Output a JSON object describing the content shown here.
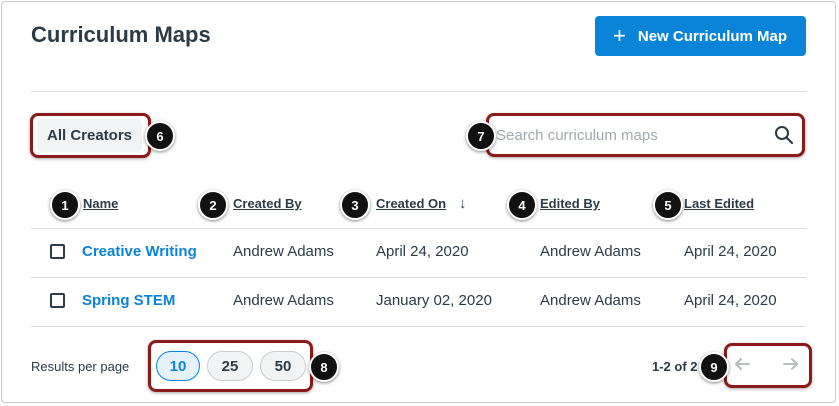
{
  "header": {
    "title": "Curriculum Maps",
    "new_button_label": "New Curriculum Map",
    "new_button_icon": "plus-icon"
  },
  "filter": {
    "creators_label": "All Creators"
  },
  "search": {
    "placeholder": "Search curriculum maps",
    "value": "",
    "icon": "search-icon"
  },
  "table": {
    "columns": [
      "Name",
      "Created By",
      "Created On",
      "Edited By",
      "Last Edited"
    ],
    "sort_indicator": "↓",
    "rows": [
      {
        "name": "Creative Writing",
        "created_by": "Andrew Adams",
        "created_on": "April 24, 2020",
        "edited_by": "Andrew Adams",
        "last_edited": "April 24, 2020"
      },
      {
        "name": "Spring STEM",
        "created_by": "Andrew Adams",
        "created_on": "January 02, 2020",
        "edited_by": "Andrew Adams",
        "last_edited": "April 24, 2020"
      }
    ]
  },
  "pagination": {
    "results_per_page_label": "Results per page",
    "page_sizes": [
      "10",
      "25",
      "50"
    ],
    "selected_size": "10",
    "range_text": "1-2 of 2",
    "prev_icon": "arrow-left-icon",
    "next_icon": "arrow-right-icon"
  },
  "annotations": [
    "1",
    "2",
    "3",
    "4",
    "5",
    "6",
    "7",
    "8",
    "9"
  ],
  "colors": {
    "primary": "#0a84d9",
    "text": "#2d3b45",
    "highlight_border": "#8b1a1a",
    "badge": "#111111"
  }
}
